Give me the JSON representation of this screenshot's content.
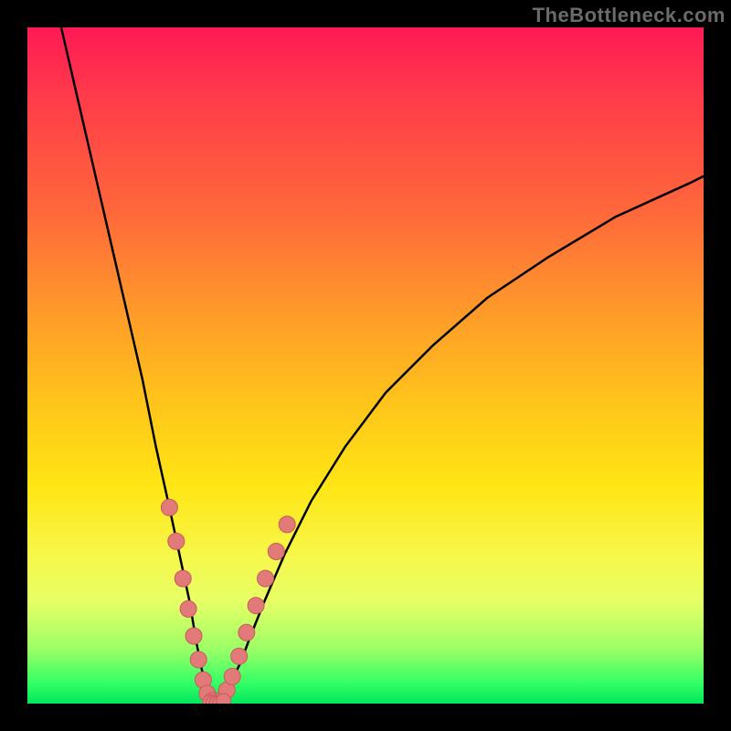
{
  "watermark": "TheBottleneck.com",
  "colors": {
    "frame": "#000000",
    "curve": "#000000",
    "marker_fill": "#e27a7a",
    "marker_stroke": "#c85a5a"
  },
  "chart_data": {
    "type": "line",
    "title": "",
    "xlabel": "",
    "ylabel": "",
    "xlim": [
      0,
      100
    ],
    "ylim": [
      0,
      100
    ],
    "grid": false,
    "legend": false,
    "note": "Bottleneck-style V-curve. y here is a visual percentage (0 = bottom / green / no bottleneck, 100 = top / red / severe). x is an arbitrary parameter. Values estimated from pixels.",
    "series": [
      {
        "name": "left-branch",
        "x": [
          5,
          8,
          11,
          14,
          17,
          19,
          21,
          22.5,
          24,
          25,
          25.8,
          26.5,
          27,
          27.5,
          28
        ],
        "y": [
          100,
          87,
          74,
          61,
          48,
          38,
          29,
          22,
          15,
          9,
          5,
          2.5,
          1,
          0.3,
          0
        ]
      },
      {
        "name": "right-branch",
        "x": [
          28,
          29,
          30,
          31.5,
          33,
          35,
          38,
          42,
          47,
          53,
          60,
          68,
          77,
          87,
          98,
          100
        ],
        "y": [
          0,
          1,
          3,
          6,
          10,
          15,
          22,
          30,
          38,
          46,
          53,
          60,
          66,
          72,
          77,
          78
        ]
      }
    ],
    "markers_left": {
      "name": "highlighted-points-left",
      "x": [
        21.0,
        22.0,
        23.0,
        23.8,
        24.6,
        25.3,
        26.0,
        26.6,
        27.3
      ],
      "y": [
        29.0,
        24.0,
        18.5,
        14.0,
        10.0,
        6.5,
        3.5,
        1.5,
        0.4
      ]
    },
    "markers_right": {
      "name": "highlighted-points-right",
      "x": [
        28.7,
        29.5,
        30.3,
        31.3,
        32.4,
        33.8,
        35.2,
        36.8,
        38.4
      ],
      "y": [
        0.5,
        2.0,
        4.0,
        7.0,
        10.5,
        14.5,
        18.5,
        22.5,
        26.5
      ]
    },
    "markers_bottom": {
      "name": "valley-cluster",
      "x": [
        27.0,
        27.5,
        28.0,
        28.5,
        29.0
      ],
      "y": [
        0.2,
        0.1,
        0.1,
        0.15,
        0.4
      ]
    }
  }
}
